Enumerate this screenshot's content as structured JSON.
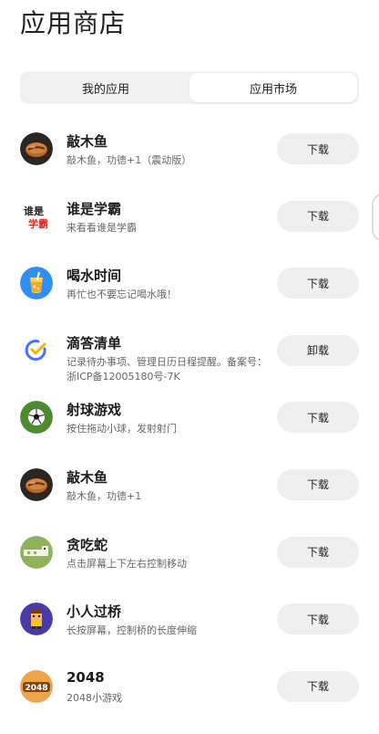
{
  "page": {
    "title": "应用商店"
  },
  "tabs": [
    {
      "label": "我的应用",
      "active": false
    },
    {
      "label": "应用市场",
      "active": true
    }
  ],
  "apps": [
    {
      "name": "敲木鱼",
      "desc": "敲木鱼，功德+1（震动版）",
      "button": "下载",
      "icon": "wooden-fish-icon"
    },
    {
      "name": "谁是学霸",
      "desc": "来看看谁是学霸",
      "button": "下载",
      "icon": "scholar-text-icon"
    },
    {
      "name": "喝水时间",
      "desc": "再忙也不要忘记喝水哦！",
      "button": "下载",
      "icon": "water-cup-icon"
    },
    {
      "name": "滴答清单",
      "desc": "记录待办事项、管理日历日程提醒。备案号：浙ICP备12005180号-7K",
      "button": "卸载",
      "icon": "ticktick-check-icon"
    },
    {
      "name": "射球游戏",
      "desc": "按住拖动小球，发射射门",
      "button": "下载",
      "icon": "soccer-ball-icon"
    },
    {
      "name": "敲木鱼",
      "desc": "敲木鱼，功德+1",
      "button": "下载",
      "icon": "wooden-fish-icon"
    },
    {
      "name": "贪吃蛇",
      "desc": "点击屏幕上下左右控制移动",
      "button": "下载",
      "icon": "snake-icon"
    },
    {
      "name": "小人过桥",
      "desc": "长按屏幕，控制桥的长度伸缩",
      "button": "下载",
      "icon": "pixel-character-icon"
    },
    {
      "name": "2048",
      "desc": "2048小游戏",
      "button": "下载",
      "icon": "game-2048-icon"
    }
  ],
  "icon_text": {
    "scholar_line1": "谁是",
    "scholar_line2": "学霸",
    "game_2048": "2048"
  },
  "colors": {
    "tab_track": "#f1f1f1",
    "button_bg": "#efefef",
    "water_blue": "#2f8ff7",
    "ticktick_blue": "#4772fa",
    "soccer_green": "#4e8a2f",
    "snake_green": "#8fb35a",
    "pixel_purple": "#4a3aa8",
    "game_2048_orange": "#f0a44a"
  }
}
